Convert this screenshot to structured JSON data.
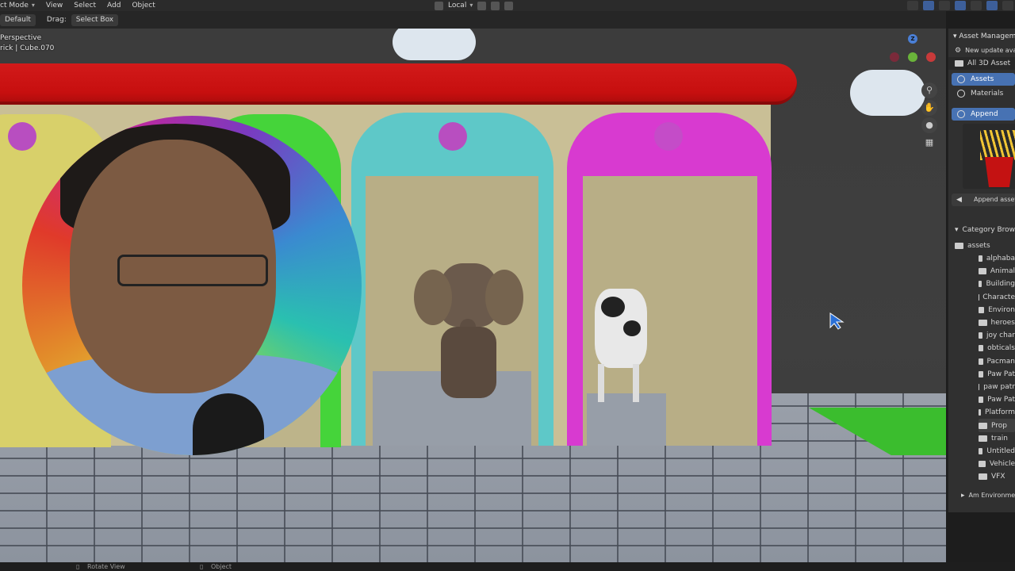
{
  "header": {
    "mode": "ct Mode",
    "menus": [
      "View",
      "Select",
      "Add",
      "Object"
    ],
    "orientation": "Local"
  },
  "toolbar": {
    "orientation_label": "Default",
    "drag_label": "Drag:",
    "drag_value": "Select Box"
  },
  "viewport": {
    "view_name": "Perspective",
    "object_path": "rick | Cube.070",
    "gizmo_axes": [
      "Z"
    ]
  },
  "asset_panel": {
    "title": "Asset Managem",
    "update_notice": "New update avai",
    "library": "All 3D Asset",
    "assets_tab": "Assets",
    "materials_tab": "Materials",
    "append_label": "Append",
    "append_asset_label": "Append asset",
    "category_browser": "Category Brows",
    "root": "assets",
    "categories": [
      "alphaba",
      "Animal",
      "Building",
      "Characte",
      "Environ",
      "heroes",
      "joy char",
      "obticals",
      "Pacman",
      "Paw Pat",
      "paw patr",
      "Paw Pat",
      "Platform",
      "Prop",
      "train",
      "Untitled",
      "Vehicle",
      "VFX"
    ],
    "selected_category": "Prop",
    "footer": "Am Environmen"
  },
  "statusbar": {
    "hint1": "Rotate View",
    "hint2": "Object"
  },
  "colors": {
    "roof": "#c70f0f",
    "wall": "#c9bf96",
    "arch_cyan": "#5ec8c8",
    "arch_magenta": "#d83ad0",
    "arch_green": "#45d43a",
    "arch_yellow": "#d8d06a",
    "dot": "#b84ec0",
    "selection": "#4772b3"
  }
}
